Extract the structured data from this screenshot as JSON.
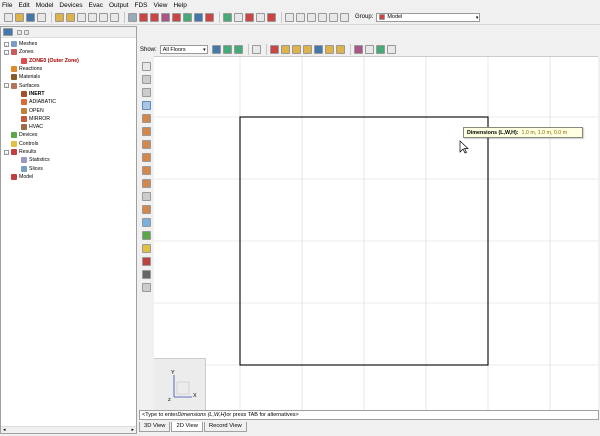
{
  "menu": [
    "File",
    "Edit",
    "Model",
    "Devices",
    "Evac",
    "Output",
    "FDS",
    "View",
    "Help"
  ],
  "toolbar": {
    "group_label": "Group:",
    "group_value": "Model"
  },
  "viewbar": {
    "show_label": "Show:",
    "show_value": "All Floors"
  },
  "tree": {
    "meshes": "Meshes",
    "zones": "Zones",
    "zone0": "ZONE0 (Outer Zone)",
    "reactions": "Reactions",
    "materials": "Materials",
    "surfaces": "Surfaces",
    "surface_items": [
      "INERT",
      "ADIABATIC",
      "OPEN",
      "MIRROR",
      "HVAC"
    ],
    "devices": "Devices",
    "controls": "Controls",
    "results": "Results",
    "statistics": "Statistics",
    "slices": "Slices",
    "model": "Model"
  },
  "tooltip": {
    "label": "Dimensions (L,W,H):",
    "value": "1.0 m, 1.0 m, 0.0 m"
  },
  "axes": {
    "y": "Y",
    "x": "X",
    "z": "Z"
  },
  "status": {
    "prefix": "<Type to enter ",
    "em": "Dimensions (L,W,H)",
    "suffix": " or press TAB for alternatives>"
  },
  "tabs": [
    "3D View",
    "2D View",
    "Record View"
  ],
  "colors": {
    "tooltip_bg": "#ffffe1",
    "tooltip_value": "#8a6a00",
    "grid": "#d0d0d0"
  }
}
